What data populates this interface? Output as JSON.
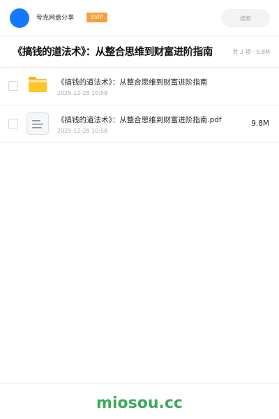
{
  "header": {
    "user_name": "夸克网盘分享",
    "badge": "SVIP",
    "search_placeholder": "搜索"
  },
  "folder": {
    "title": "《搞钱的道法术》：从整合思维到财富进阶指南",
    "meta": "共 2 项 · 9.8M"
  },
  "files": [
    {
      "name": "《搞钱的道法术》：从整合思维到财富进阶指南",
      "date": "2025-12-28 10:58",
      "size": "",
      "icon": "folder-icon"
    },
    {
      "name": "《搞钱的道法术》：从整合思维到财富进阶指南.pdf",
      "date": "2025-12-28 10:58",
      "size": "9.8M",
      "icon": "document-icon"
    }
  ],
  "footer": {
    "watermark": "miosou.cc"
  },
  "colors": {
    "avatar": "#1677ff",
    "svip_badge": "#f7a03a",
    "folder": "#ffc62a",
    "watermark": "#3aaa5a"
  }
}
